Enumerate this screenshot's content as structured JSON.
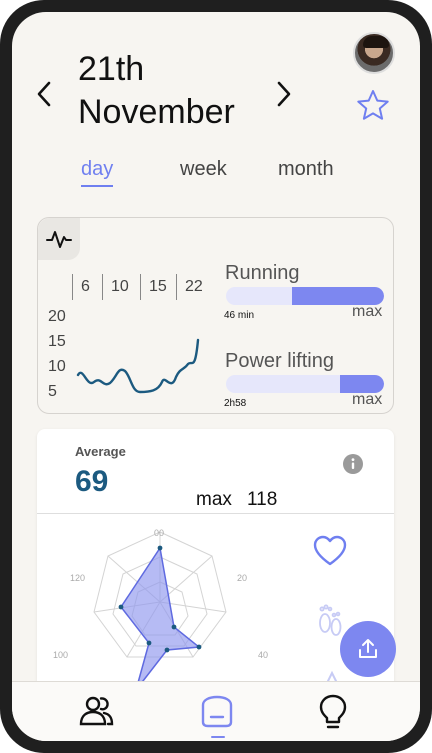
{
  "header": {
    "date_line1": "21th",
    "date_line2": "November",
    "prev_icon": "chevron-left-icon",
    "next_icon": "chevron-right-icon",
    "favorite_icon": "star-icon",
    "avatar_icon": "user-avatar"
  },
  "tabs": [
    {
      "label": "day",
      "active": true
    },
    {
      "label": "week",
      "active": false
    },
    {
      "label": "month",
      "active": false
    }
  ],
  "activity": {
    "badge_icon": "pulse-icon",
    "hours": [
      "6",
      "10",
      "15",
      "22"
    ],
    "y_ticks": [
      "20",
      "15",
      "10",
      "5"
    ],
    "metrics": [
      {
        "label": "Running",
        "value_text": "46 min",
        "max_label": "max",
        "fill_fraction": 0.58
      },
      {
        "label": "Power lifting",
        "value_text": "2h58",
        "max_label": "max",
        "fill_fraction": 0.28
      }
    ]
  },
  "stats": {
    "average_label": "Average",
    "average_value": "69",
    "max_label": "max",
    "max_value": "118",
    "info_icon": "info-icon",
    "radar_labels": [
      "00",
      "20",
      "40",
      "100",
      "120"
    ],
    "side_icons": [
      "heart-icon",
      "footprints-icon"
    ]
  },
  "colors": {
    "accent": "#7d87f0",
    "average_value": "#1c5a80",
    "wave_line": "#1c5a80",
    "background": "#f7f5f1"
  },
  "fab_icon": "share-upload-icon",
  "bottom_nav": [
    {
      "icon": "people-icon"
    },
    {
      "icon": "home-icon",
      "active": true
    },
    {
      "icon": "lightbulb-icon"
    }
  ]
}
